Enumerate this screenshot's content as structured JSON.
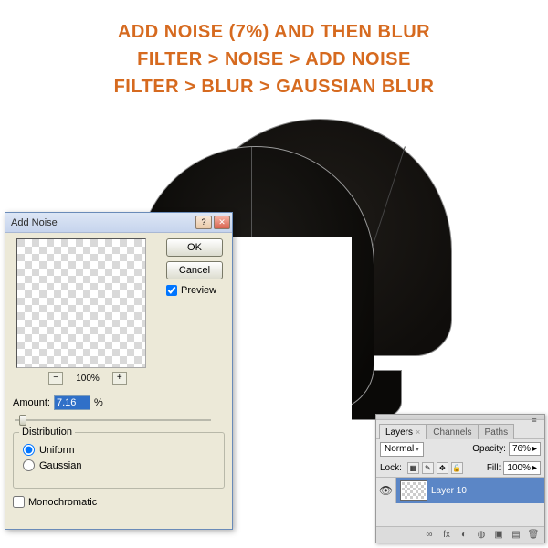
{
  "instructions": {
    "line1": "ADD NOISE (7%) AND THEN BLUR",
    "line2": "FILTER > NOISE > ADD NOISE",
    "line3": "FILTER > BLUR > GAUSSIAN BLUR"
  },
  "dialog": {
    "title": "Add Noise",
    "ok": "OK",
    "cancel": "Cancel",
    "preview_label": "Preview",
    "preview_checked": true,
    "zoom_percent": "100%",
    "zoom_minus": "−",
    "zoom_plus": "+",
    "amount_label": "Amount:",
    "amount_value": "7.16",
    "amount_unit": "%",
    "distribution_legend": "Distribution",
    "dist_uniform": "Uniform",
    "dist_gaussian": "Gaussian",
    "dist_selected": "uniform",
    "monochromatic": "Monochromatic",
    "mono_checked": false
  },
  "panel": {
    "tabs": [
      "Layers",
      "Channels",
      "Paths"
    ],
    "active_tab": 0,
    "blend_mode": "Normal",
    "opacity_label": "Opacity:",
    "opacity_value": "76%",
    "lock_label": "Lock:",
    "fill_label": "Fill:",
    "fill_value": "100%",
    "layer": {
      "name": "Layer 10",
      "visible": true
    },
    "icons": {
      "link": "∞",
      "fx": "fx",
      "mask": "◐",
      "adj": "◍",
      "folder": "▣",
      "new": "▤",
      "trash": "🗑"
    }
  }
}
